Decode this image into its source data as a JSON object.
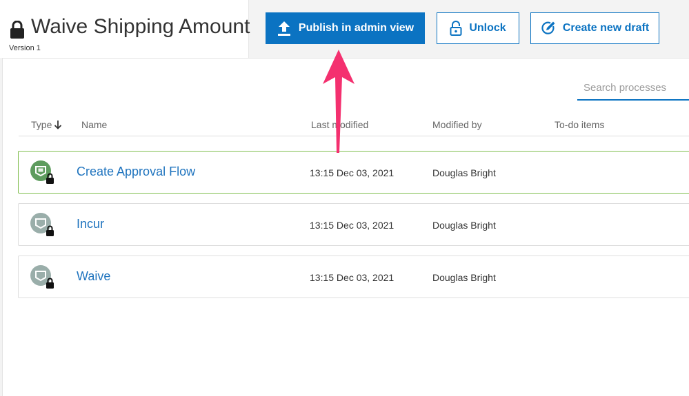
{
  "header": {
    "title": "Waive Shipping Amount",
    "version": "Version 1",
    "title_icon": "lock-icon"
  },
  "toolbar": {
    "publish_label": "Publish in admin view",
    "unlock_label": "Unlock",
    "draft_label": "Create new draft",
    "accent": "#0b73c2"
  },
  "search": {
    "placeholder": "Search processes"
  },
  "table": {
    "columns": [
      "Type",
      "Name",
      "Last modified",
      "Modified by",
      "To-do items"
    ],
    "sort_icon": "arrow-down-icon",
    "rows": [
      {
        "name": "Create Approval Flow",
        "last_modified": "13:15 Dec 03, 2021",
        "modified_by": "Douglas Bright",
        "todo": "",
        "type_icon": "process-icon",
        "icon_color": "#5e9c5e",
        "locked": true,
        "selected": true
      },
      {
        "name": "Incur",
        "last_modified": "13:15 Dec 03, 2021",
        "modified_by": "Douglas Bright",
        "todo": "",
        "type_icon": "process-icon",
        "icon_color": "#9aaeaa",
        "locked": true,
        "selected": false
      },
      {
        "name": "Waive",
        "last_modified": "13:15 Dec 03, 2021",
        "modified_by": "Douglas Bright",
        "todo": "",
        "type_icon": "process-icon",
        "icon_color": "#9aaeaa",
        "locked": true,
        "selected": false
      }
    ]
  },
  "annotation": {
    "arrow_color": "#f4306f"
  }
}
